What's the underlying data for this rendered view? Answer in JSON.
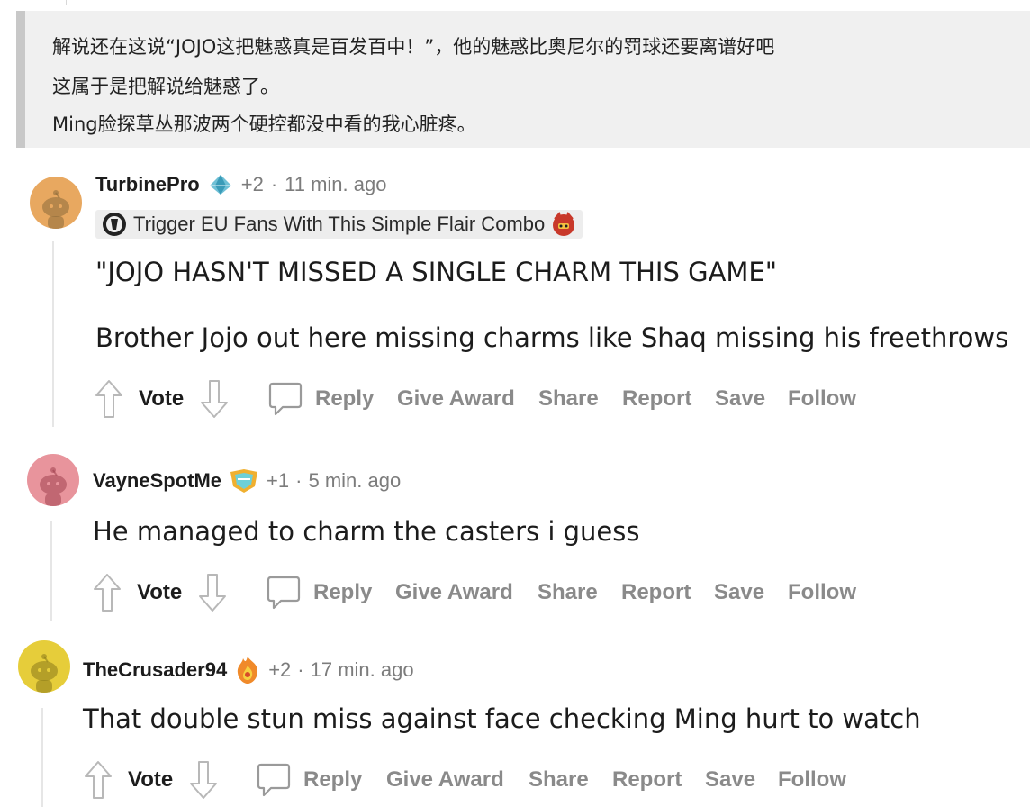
{
  "quote": {
    "lines": [
      "解说还在这说“JOJO这把魅惑真是百发百中！”，他的魅惑比奥尼尔的罚球还要离谱好吧",
      "这属于是把解说给魅惑了。",
      "Ming脸探草丛那波两个硬控都没中看的我心脏疼。"
    ]
  },
  "comments": [
    {
      "username": "TurbinePro",
      "score": "+2",
      "sep": "·",
      "time": "11 min. ago",
      "avatar_color": "#e8a860",
      "flair": "Trigger EU Fans With This Simple Flair Combo",
      "paragraphs": [
        "\"JOJO HASN'T MISSED A SINGLE CHARM THIS GAME\"",
        "Brother Jojo out here missing charms like Shaq missing his freethrows"
      ]
    },
    {
      "username": "VayneSpotMe",
      "score": "+1",
      "sep": "·",
      "time": "5 min. ago",
      "avatar_color": "#e8949c",
      "paragraphs": [
        "He managed to charm the casters i guess"
      ]
    },
    {
      "username": "TheCrusader94",
      "score": "+2",
      "sep": "·",
      "time": "17 min. ago",
      "avatar_color": "#e6cd3a",
      "paragraphs": [
        "That double stun miss against face checking Ming hurt to watch"
      ]
    }
  ],
  "actions": {
    "vote": "Vote",
    "reply": "Reply",
    "give_award": "Give Award",
    "share": "Share",
    "report": "Report",
    "save": "Save",
    "follow": "Follow"
  },
  "colors": {
    "quote_bg": "#f0f0f0",
    "quote_bar": "#c8c8c8",
    "action_gray": "#8a8a8a",
    "meta_gray": "#7c7c7c"
  }
}
